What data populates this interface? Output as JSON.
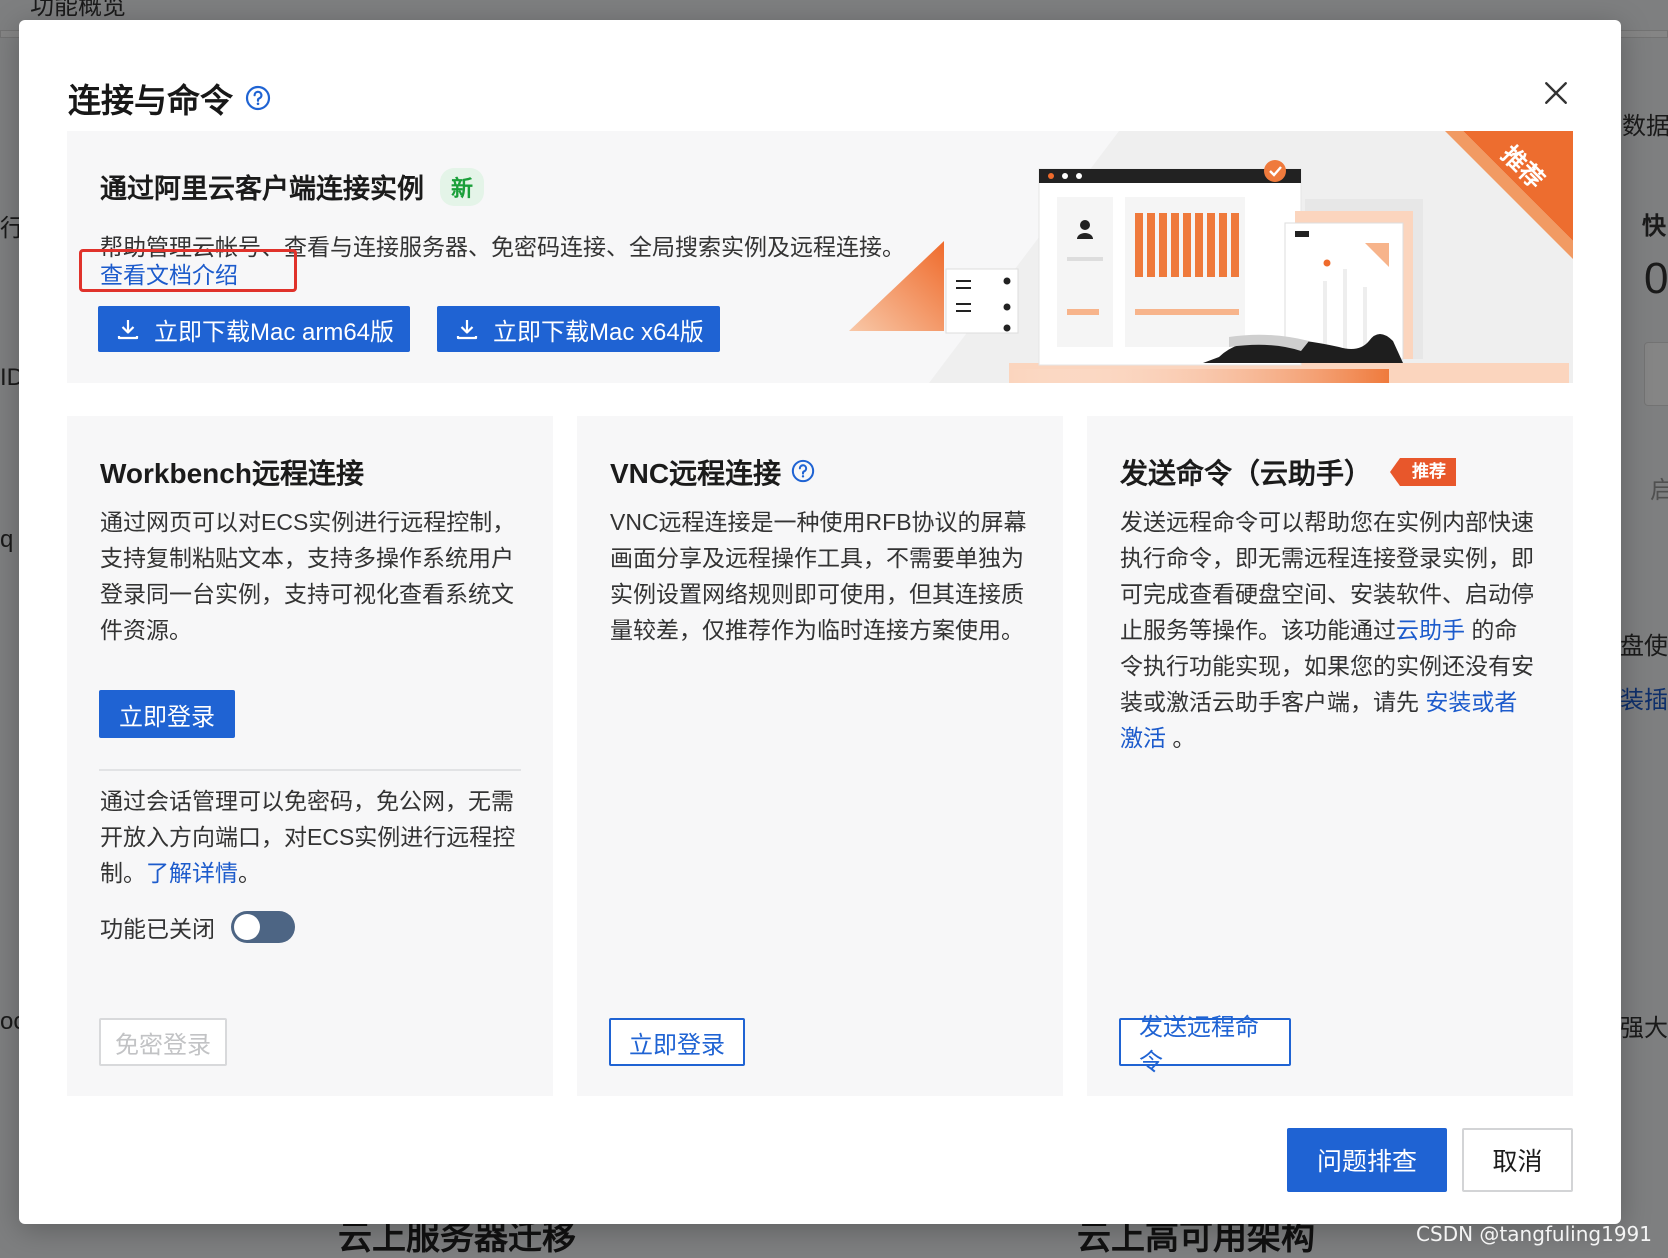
{
  "background": {
    "top_label": "功能概览",
    "right_labels": [
      "数据",
      "快",
      "0",
      "启",
      "盘使",
      "装插",
      "强大的"
    ],
    "left_labels": [
      "行",
      "ID",
      "q",
      "oc"
    ],
    "bottom_left_heading": "云上服务器迁移",
    "bottom_right_heading": "云上高可用架构"
  },
  "modal": {
    "title": "连接与命令",
    "help_icon": "question-circle-icon",
    "close_icon": "close-icon"
  },
  "banner": {
    "title": "通过阿里云客户端连接实例",
    "new_badge": "新",
    "description": "帮助管理云帐号、查看与连接服务器、免密码连接、全局搜索实例及远程连接。",
    "doc_link": "查看文档介绍",
    "download_arm": "立即下载Mac arm64版",
    "download_x64": "立即下载Mac x64版",
    "ribbon": "推荐",
    "accent_color": "#ed6d2f"
  },
  "workbench": {
    "title": "Workbench远程连接",
    "description": "通过网页可以对ECS实例进行远程控制，支持复制粘贴文本，支持多操作系统用户登录同一台实例，支持可视化查看系统文件资源。",
    "login_button": "立即登录",
    "session_text": "通过会话管理可以免密码，免公网，无需开放入方向端口，对ECS实例进行远程控制。",
    "session_link": "了解详情",
    "session_suffix": "。",
    "toggle_label": "功能已关闭",
    "toggle_on": false,
    "passwordless_button": "免密登录"
  },
  "vnc": {
    "title": "VNC远程连接",
    "description": "VNC远程连接是一种使用RFB协议的屏幕画面分享及远程操作工具，不需要单独为实例设置网络规则即可使用，但其连接质量较差，仅推荐作为临时连接方案使用。",
    "login_button": "立即登录"
  },
  "command": {
    "title": "发送命令（云助手）",
    "tag": "推荐",
    "desc_part1": "发送远程命令可以帮助您在实例内部快速执行命令，即无需远程连接登录实例，即可完成查看硬盘空间、安装软件、启动停止服务等操作。该功能通过",
    "desc_link1": "云助手",
    "desc_part2": " 的命令执行功能实现，如果您的实例还没有安装或激活云助手客户端，请先 ",
    "desc_link2": "安装或者激活",
    "desc_part3": " 。",
    "send_button": "发送远程命令"
  },
  "footer": {
    "troubleshoot": "问题排查",
    "cancel": "取消"
  },
  "watermark": "CSDN @tangfuling1991",
  "colors": {
    "primary": "#1f63d3",
    "link": "#1c5bcc",
    "highlight_box": "#e0322b",
    "orange": "#ed6d2f",
    "card_bg": "#f7f7f8"
  }
}
